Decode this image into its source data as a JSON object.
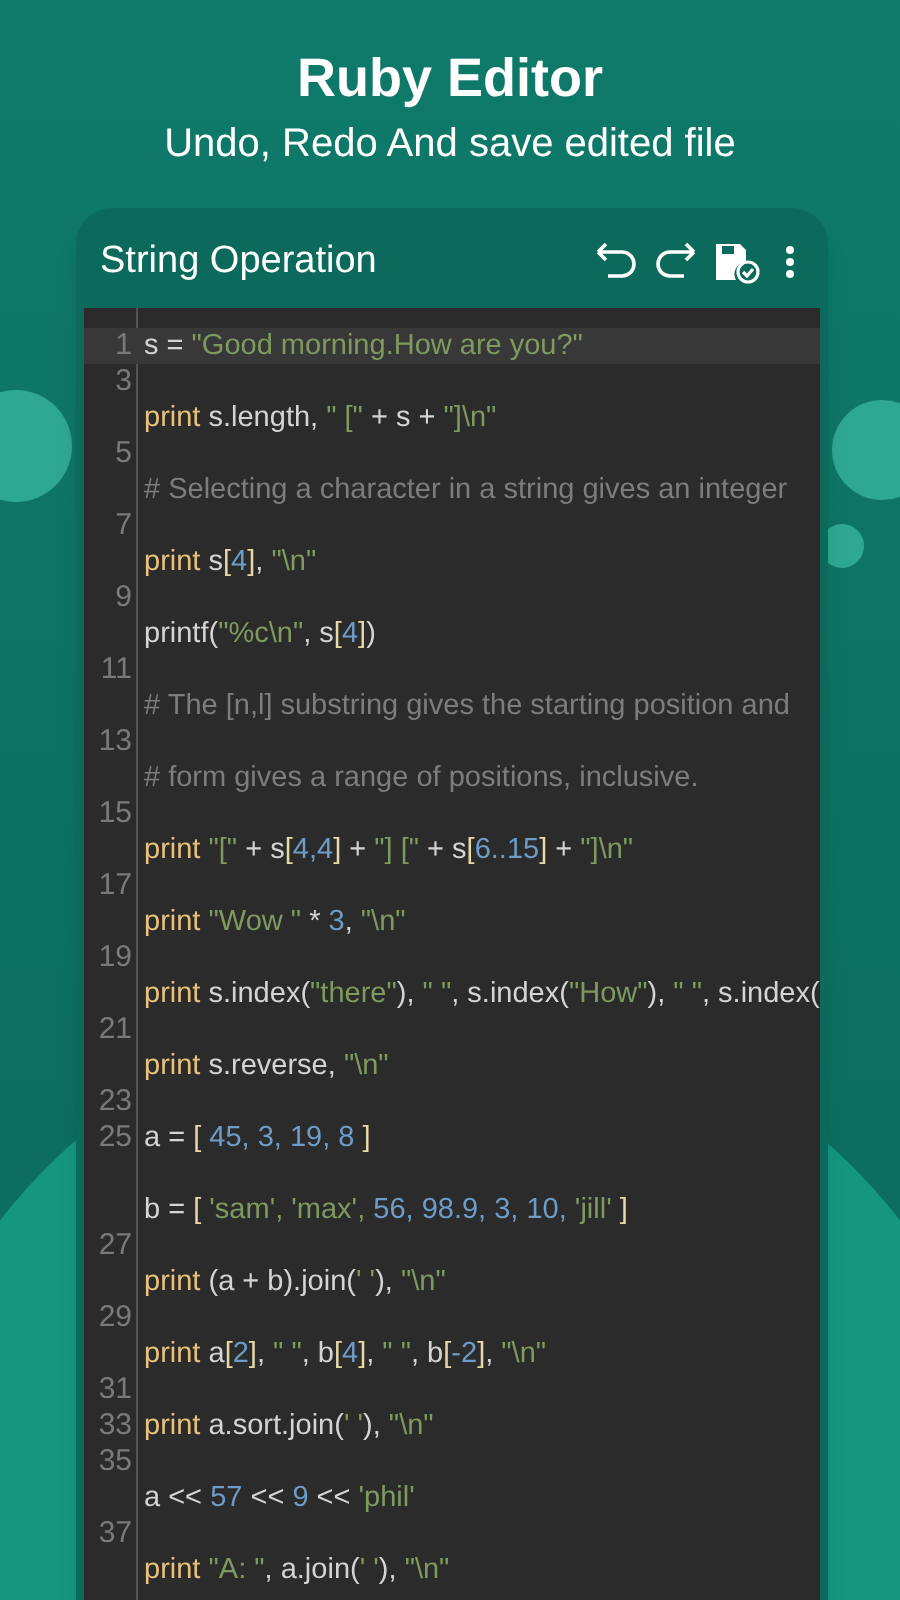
{
  "promo": {
    "title": "Ruby Editor",
    "subtitle": "Undo, Redo And save edited file"
  },
  "toolbar": {
    "title": "String Operation"
  },
  "editor": {
    "rows": [
      {
        "number": "1",
        "current": true,
        "tokens": [
          {
            "kind": "plain",
            "text": "s = "
          },
          {
            "kind": "string",
            "text": "\"Good morning.How are you?\""
          }
        ]
      },
      {
        "number": "3",
        "current": false,
        "tokens": []
      },
      {
        "number": "",
        "current": false,
        "tokens": [
          {
            "kind": "keyword",
            "text": "print"
          },
          {
            "kind": "plain",
            "text": " s.length, "
          },
          {
            "kind": "string",
            "text": "\" [\""
          },
          {
            "kind": "plain",
            "text": " + s + "
          },
          {
            "kind": "string",
            "text": "\"]\\n\""
          }
        ]
      },
      {
        "number": "5",
        "current": false,
        "tokens": []
      },
      {
        "number": "",
        "current": false,
        "tokens": [
          {
            "kind": "comment",
            "text": "# Selecting a character in a string gives an integer"
          }
        ]
      },
      {
        "number": "7",
        "current": false,
        "tokens": []
      },
      {
        "number": "",
        "current": false,
        "tokens": [
          {
            "kind": "keyword",
            "text": "print"
          },
          {
            "kind": "plain",
            "text": " s"
          },
          {
            "kind": "bracket",
            "text": "["
          },
          {
            "kind": "number",
            "text": "4"
          },
          {
            "kind": "bracket",
            "text": "]"
          },
          {
            "kind": "plain",
            "text": ", "
          },
          {
            "kind": "string",
            "text": "\"\\n\""
          }
        ]
      },
      {
        "number": "9",
        "current": false,
        "tokens": []
      },
      {
        "number": "",
        "current": false,
        "tokens": [
          {
            "kind": "plain",
            "text": "printf("
          },
          {
            "kind": "string",
            "text": "\"%c\\n\""
          },
          {
            "kind": "plain",
            "text": ", s"
          },
          {
            "kind": "bracket",
            "text": "["
          },
          {
            "kind": "number",
            "text": "4"
          },
          {
            "kind": "bracket",
            "text": "]"
          },
          {
            "kind": "plain",
            "text": ")"
          }
        ]
      },
      {
        "number": "11",
        "current": false,
        "tokens": []
      },
      {
        "number": "",
        "current": false,
        "tokens": [
          {
            "kind": "comment",
            "text": "# The [n,l] substring gives the starting position and"
          }
        ]
      },
      {
        "number": "13",
        "current": false,
        "tokens": []
      },
      {
        "number": "",
        "current": false,
        "tokens": [
          {
            "kind": "comment",
            "text": "# form gives a range of positions, inclusive."
          }
        ]
      },
      {
        "number": "15",
        "current": false,
        "tokens": []
      },
      {
        "number": "",
        "current": false,
        "tokens": [
          {
            "kind": "keyword",
            "text": "print "
          },
          {
            "kind": "string",
            "text": "\"[\""
          },
          {
            "kind": "plain",
            "text": " + s"
          },
          {
            "kind": "bracket",
            "text": "["
          },
          {
            "kind": "number",
            "text": "4,4"
          },
          {
            "kind": "bracket",
            "text": "]"
          },
          {
            "kind": "plain",
            "text": " + "
          },
          {
            "kind": "string",
            "text": "\"] [\""
          },
          {
            "kind": "plain",
            "text": " + s"
          },
          {
            "kind": "bracket",
            "text": "["
          },
          {
            "kind": "number",
            "text": "6..15"
          },
          {
            "kind": "bracket",
            "text": "]"
          },
          {
            "kind": "plain",
            "text": " + "
          },
          {
            "kind": "string",
            "text": "\"]\\n\""
          }
        ]
      },
      {
        "number": "17",
        "current": false,
        "tokens": []
      },
      {
        "number": "",
        "current": false,
        "tokens": [
          {
            "kind": "keyword",
            "text": "print "
          },
          {
            "kind": "string",
            "text": "\"Wow \""
          },
          {
            "kind": "plain",
            "text": " * "
          },
          {
            "kind": "number",
            "text": "3"
          },
          {
            "kind": "plain",
            "text": ", "
          },
          {
            "kind": "string",
            "text": "\"\\n\""
          }
        ]
      },
      {
        "number": "19",
        "current": false,
        "tokens": []
      },
      {
        "number": "",
        "current": false,
        "tokens": [
          {
            "kind": "keyword",
            "text": "print"
          },
          {
            "kind": "plain",
            "text": " s.index("
          },
          {
            "kind": "string",
            "text": "\"there\""
          },
          {
            "kind": "plain",
            "text": "), "
          },
          {
            "kind": "string",
            "text": "\" \""
          },
          {
            "kind": "plain",
            "text": ", s.index("
          },
          {
            "kind": "string",
            "text": "\"How\""
          },
          {
            "kind": "plain",
            "text": "), "
          },
          {
            "kind": "string",
            "text": "\" \""
          },
          {
            "kind": "plain",
            "text": ", s.index("
          }
        ]
      },
      {
        "number": "21",
        "current": false,
        "tokens": []
      },
      {
        "number": "",
        "current": false,
        "tokens": [
          {
            "kind": "keyword",
            "text": "print"
          },
          {
            "kind": "plain",
            "text": " s.reverse, "
          },
          {
            "kind": "string",
            "text": "\"\\n\""
          }
        ]
      },
      {
        "number": "23",
        "current": false,
        "tokens": []
      },
      {
        "number": "25",
        "current": false,
        "tokens": [
          {
            "kind": "plain",
            "text": "a = "
          },
          {
            "kind": "bracket",
            "text": "["
          },
          {
            "kind": "number",
            "text": " 45, 3, 19, 8 "
          },
          {
            "kind": "bracket",
            "text": "]"
          }
        ]
      },
      {
        "number": "",
        "current": false,
        "tokens": []
      },
      {
        "number": "",
        "current": false,
        "tokens": [
          {
            "kind": "plain",
            "text": "b = "
          },
          {
            "kind": "bracket",
            "text": "["
          },
          {
            "kind": "string",
            "text": " 'sam', 'max', "
          },
          {
            "kind": "number",
            "text": "56, 98.9, 3, 10, "
          },
          {
            "kind": "string",
            "text": "'jill' "
          },
          {
            "kind": "bracket",
            "text": "]"
          }
        ]
      },
      {
        "number": "27",
        "current": false,
        "tokens": []
      },
      {
        "number": "",
        "current": false,
        "tokens": [
          {
            "kind": "keyword",
            "text": "print"
          },
          {
            "kind": "plain",
            "text": " (a + b).join("
          },
          {
            "kind": "string",
            "text": "' '"
          },
          {
            "kind": "plain",
            "text": "), "
          },
          {
            "kind": "string",
            "text": "\"\\n\""
          }
        ]
      },
      {
        "number": "29",
        "current": false,
        "tokens": []
      },
      {
        "number": "",
        "current": false,
        "tokens": [
          {
            "kind": "keyword",
            "text": "print"
          },
          {
            "kind": "plain",
            "text": " a"
          },
          {
            "kind": "bracket",
            "text": "["
          },
          {
            "kind": "number",
            "text": "2"
          },
          {
            "kind": "bracket",
            "text": "]"
          },
          {
            "kind": "plain",
            "text": ", "
          },
          {
            "kind": "string",
            "text": "\" \""
          },
          {
            "kind": "plain",
            "text": ", b"
          },
          {
            "kind": "bracket",
            "text": "["
          },
          {
            "kind": "number",
            "text": "4"
          },
          {
            "kind": "bracket",
            "text": "]"
          },
          {
            "kind": "plain",
            "text": ", "
          },
          {
            "kind": "string",
            "text": "\" \""
          },
          {
            "kind": "plain",
            "text": ", b"
          },
          {
            "kind": "bracket",
            "text": "["
          },
          {
            "kind": "number",
            "text": "-2"
          },
          {
            "kind": "bracket",
            "text": "]"
          },
          {
            "kind": "plain",
            "text": ", "
          },
          {
            "kind": "string",
            "text": "\"\\n\""
          }
        ]
      },
      {
        "number": "31",
        "current": false,
        "tokens": []
      },
      {
        "number": "33",
        "current": false,
        "tokens": [
          {
            "kind": "keyword",
            "text": "print"
          },
          {
            "kind": "plain",
            "text": " a.sort.join("
          },
          {
            "kind": "string",
            "text": "' '"
          },
          {
            "kind": "plain",
            "text": "), "
          },
          {
            "kind": "string",
            "text": "\"\\n\""
          }
        ]
      },
      {
        "number": "35",
        "current": false,
        "tokens": []
      },
      {
        "number": "",
        "current": false,
        "tokens": [
          {
            "kind": "plain",
            "text": "a << "
          },
          {
            "kind": "number",
            "text": "57"
          },
          {
            "kind": "plain",
            "text": " << "
          },
          {
            "kind": "number",
            "text": "9"
          },
          {
            "kind": "plain",
            "text": " << "
          },
          {
            "kind": "string",
            "text": "'phil'"
          }
        ]
      },
      {
        "number": "37",
        "current": false,
        "tokens": []
      },
      {
        "number": "",
        "current": false,
        "tokens": [
          {
            "kind": "keyword",
            "text": "print "
          },
          {
            "kind": "string",
            "text": "\"A: \""
          },
          {
            "kind": "plain",
            "text": ", a.join("
          },
          {
            "kind": "string",
            "text": "' '"
          },
          {
            "kind": "plain",
            "text": "), "
          },
          {
            "kind": "string",
            "text": "\"\\n\""
          }
        ]
      }
    ]
  }
}
